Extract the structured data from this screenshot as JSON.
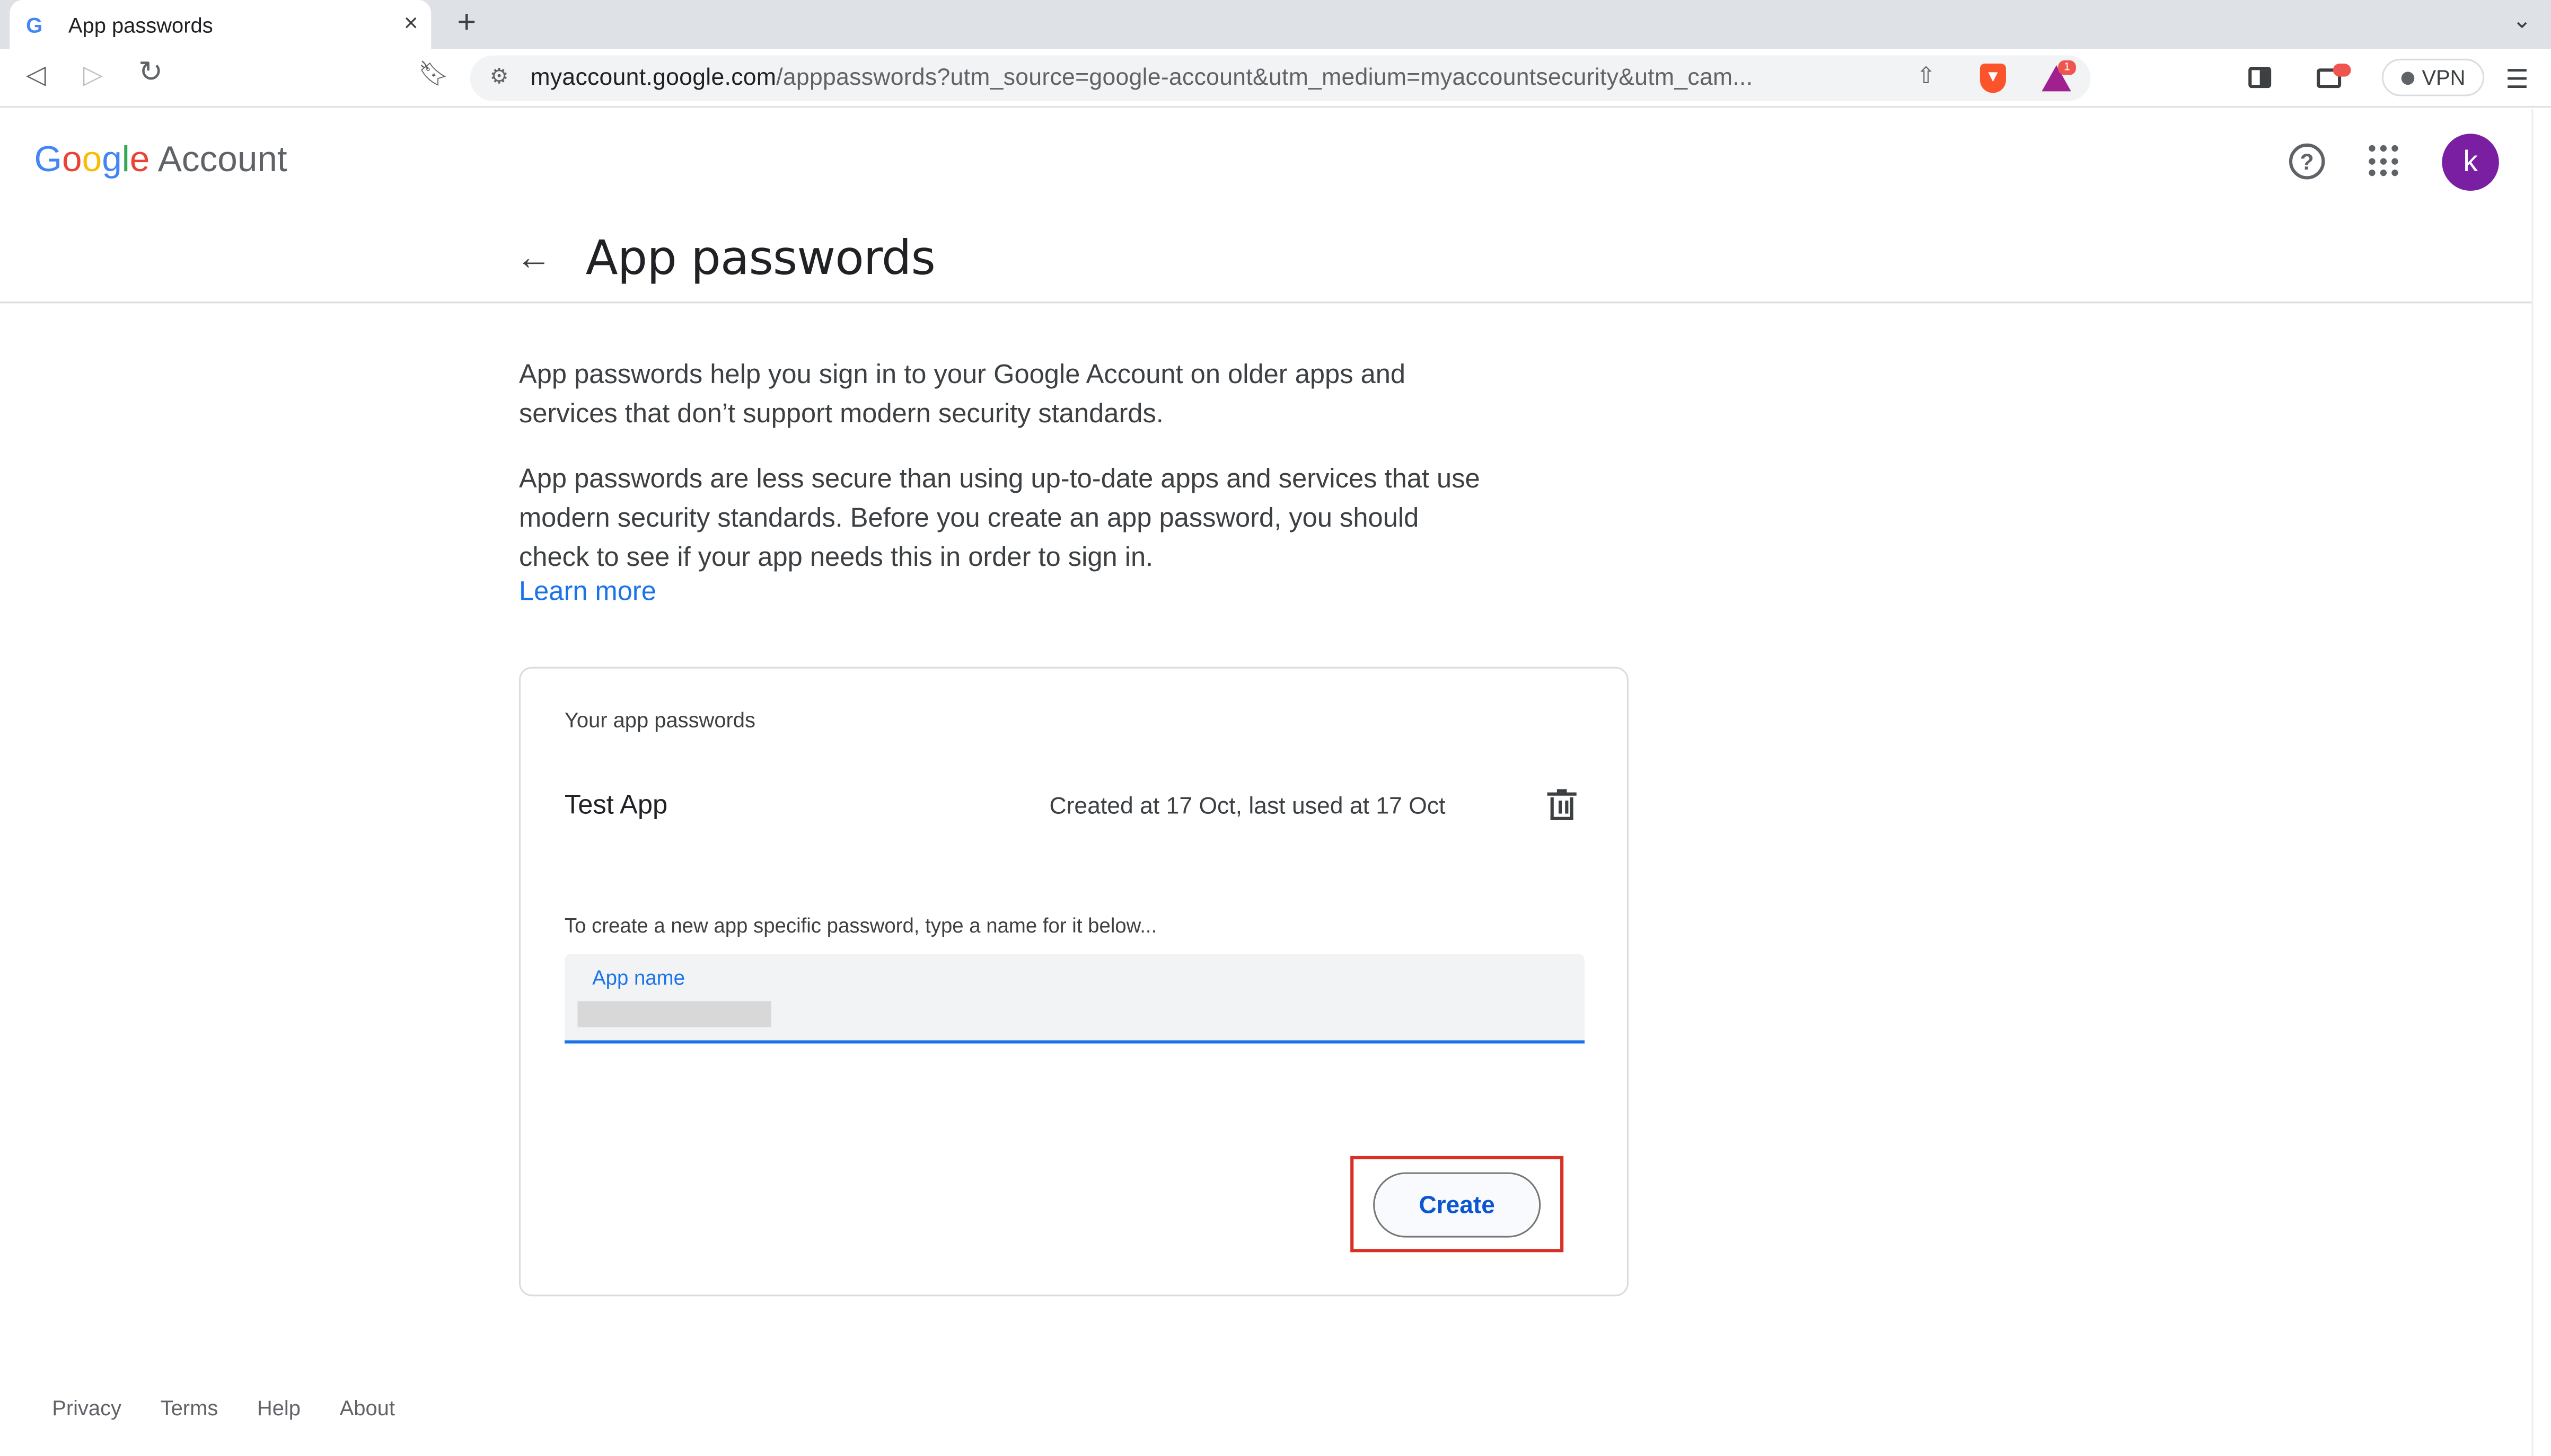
{
  "browser": {
    "tab_title": "App passwords",
    "tab_favicon": "G",
    "tab_close": "×",
    "new_tab": "+",
    "tab_menu": "⌄",
    "url_host": "myaccount.google.com",
    "url_path": "/apppasswords?utm_source=google-account&utm_medium=myaccountsecurity&utm_cam...",
    "vpn_label": "VPN",
    "rewards_badge": "1",
    "icons": [
      "back-icon",
      "forward-icon",
      "reload-icon",
      "bookmark-icon",
      "site-info-icon",
      "share-icon",
      "brave-shield-icon",
      "brave-rewards-icon",
      "sidebar-icon",
      "wallet-icon",
      "menu-icon"
    ]
  },
  "header": {
    "brand_letters": [
      "G",
      "o",
      "o",
      "g",
      "l",
      "e"
    ],
    "brand_suffix": "Account",
    "avatar_letter": "k",
    "brand_colors": [
      "#4285f4",
      "#ea4335",
      "#fbbc05",
      "#4285f4",
      "#34a853",
      "#ea4335"
    ],
    "avatar_color": "#7b1fa2"
  },
  "page": {
    "title": "App passwords",
    "intro": "App passwords help you sign in to your Google Account on older apps and services that don’t support modern security standards.",
    "warning": "App passwords are less secure than using up-to-date apps and services that use modern security standards. Before you create an app password, you should check to see if your app needs this in order to sign in.",
    "learn_more": "Learn more"
  },
  "card": {
    "heading": "Your app passwords",
    "passwords": [
      {
        "name": "Test App",
        "meta": "Created at 17 Oct, last used at 17 Oct"
      }
    ],
    "create_hint": "To create a new app specific password, type a name for it below...",
    "input_label": "App name",
    "input_value": "",
    "create_button": "Create",
    "accent_color": "#1a73e8",
    "highlight_color": "#d93025"
  },
  "footer": {
    "links": [
      "Privacy",
      "Terms",
      "Help",
      "About"
    ]
  }
}
